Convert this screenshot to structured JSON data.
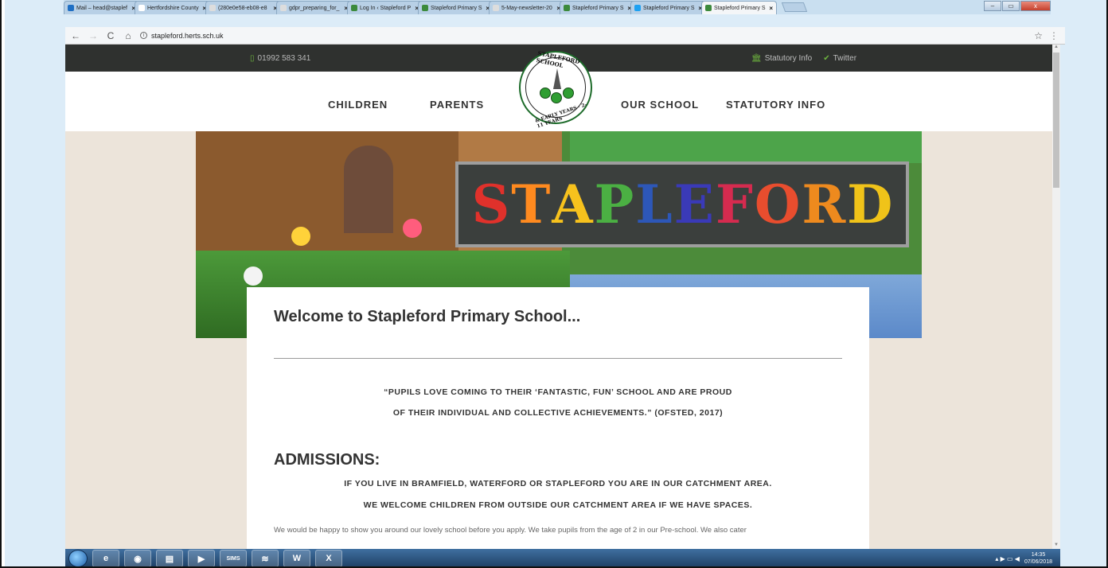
{
  "browser": {
    "tabs": [
      {
        "label": "Mail – head@staplef",
        "color": "#1f6fc4",
        "active": false
      },
      {
        "label": "Hertfordshire County",
        "color": "#ffffff",
        "active": false
      },
      {
        "label": "(280e0e58-eb08-e8",
        "color": "#dddddd",
        "active": false
      },
      {
        "label": "gdpr_preparing_for_",
        "color": "#dddddd",
        "active": false
      },
      {
        "label": "Log In ‹ Stapleford P",
        "color": "#3c8a3c",
        "active": false
      },
      {
        "label": "Stapleford Primary S",
        "color": "#3c8a3c",
        "active": false
      },
      {
        "label": "5-May-newsletter-20",
        "color": "#dddddd",
        "active": false
      },
      {
        "label": "Stapleford Primary S",
        "color": "#3c8a3c",
        "active": false
      },
      {
        "label": "Stapleford Primary S",
        "color": "#1da1f2",
        "active": false
      },
      {
        "label": "Stapleford Primary S",
        "color": "#3c8a3c",
        "active": true
      }
    ],
    "url": "stapleford.herts.sch.uk",
    "info_glyph": "i",
    "back_glyph": "←",
    "forward_glyph": "→",
    "reload_glyph": "C",
    "home_glyph": "⌂",
    "star_glyph": "☆",
    "menu_glyph": "⋮",
    "window_buttons": {
      "minimize": "–",
      "restore": "▭",
      "close": "x"
    }
  },
  "site": {
    "topbar": {
      "phone": "01992 583 341",
      "phone_icon": "▯",
      "links": [
        {
          "icon": "🏛",
          "label": "Statutory Info"
        },
        {
          "icon": "✔",
          "label": "Twitter"
        }
      ]
    },
    "nav": {
      "children": "CHILDREN",
      "parents": "PARENTS",
      "our_school": "OUR SCHOOL",
      "statutory": "STATUTORY INFO"
    },
    "logo": {
      "top_text": "STAPLEFORD SCHOOL",
      "bottom_text": "& EARLY YEARS · 2-11 YEARS"
    },
    "hero": {
      "banner_letters": [
        "S",
        "T",
        "A",
        "P",
        "L",
        "E",
        "F",
        "O",
        "R",
        "D"
      ],
      "letter_colors": [
        "#e0312b",
        "#ff8a1f",
        "#f7c21d",
        "#4bb043",
        "#2d57b8",
        "#3a3ab8",
        "#d52b4f",
        "#e84d2e",
        "#ee8a1e",
        "#f0c319"
      ]
    },
    "content": {
      "heading": "Welcome to Stapleford Primary School...",
      "quote_line1": "“PUPILS LOVE COMING TO THEIR ‘FANTASTIC, FUN’ SCHOOL AND ARE PROUD",
      "quote_line2": "OF THEIR INDIVIDUAL AND COLLECTIVE ACHIEVEMENTS.” (OFSTED, 2017)",
      "admissions_heading": "ADMISSIONS:",
      "catchment_line1": "IF YOU LIVE IN BRAMFIELD, WATERFORD OR STAPLEFORD YOU ARE IN OUR CATCHMENT AREA.",
      "catchment_line2": "WE WELCOME CHILDREN FROM OUTSIDE OUR CATCHMENT AREA IF WE HAVE SPACES.",
      "paragraph": "We would be happy to show you around our lovely school before you apply. We take pupils from the age of 2 in our Pre-school. We also cater"
    }
  },
  "taskbar": {
    "apps": [
      {
        "name": "ie-icon",
        "glyph": "e"
      },
      {
        "name": "chrome-icon",
        "glyph": "◉"
      },
      {
        "name": "explorer-icon",
        "glyph": "▤"
      },
      {
        "name": "media-icon",
        "glyph": "▶"
      },
      {
        "name": "sims-icon",
        "glyph": "SIMS"
      },
      {
        "name": "spotify-icon",
        "glyph": "≋"
      },
      {
        "name": "word-icon",
        "glyph": "W"
      },
      {
        "name": "excel-icon",
        "glyph": "X"
      }
    ],
    "tray_glyphs": "▴ ▶ ▭ ◀",
    "time": "14:35",
    "date": "07/06/2018"
  }
}
